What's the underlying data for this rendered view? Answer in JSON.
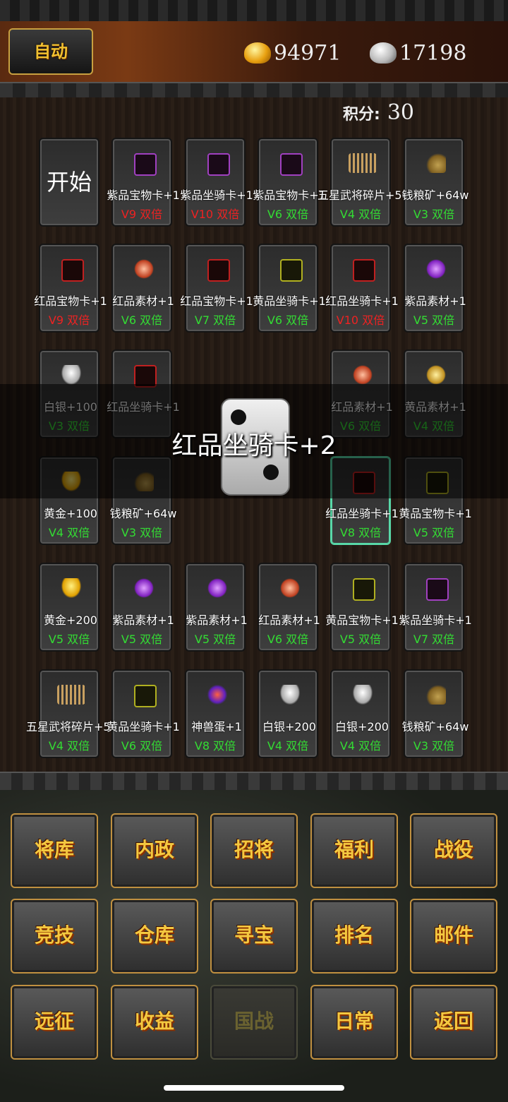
{
  "header": {
    "auto_label": "自动",
    "gold_value": "94971",
    "silver_value": "17198",
    "score_label": "积分:",
    "score_value": "30"
  },
  "board": {
    "start_label": "开始",
    "cells": [
      {
        "icon": "purple-card-icon",
        "name": "紫品宝物卡+1",
        "mult": "V9 双倍",
        "mult_color": "red"
      },
      {
        "icon": "purple-card-icon",
        "name": "紫品坐骑卡+1",
        "mult": "V10 双倍",
        "mult_color": "red"
      },
      {
        "icon": "purple-card-icon",
        "name": "紫品宝物卡+1",
        "mult": "V6 双倍",
        "mult_color": "green"
      },
      {
        "icon": "hero-shard-icon",
        "name": "五星武将碎片+50",
        "mult": "V4 双倍",
        "mult_color": "green"
      },
      {
        "icon": "ore-icon",
        "name": "钱粮矿+64w",
        "mult": "V3 双倍",
        "mult_color": "green"
      },
      {
        "icon": "red-card-icon",
        "name": "红品宝物卡+1",
        "mult": "V9 双倍",
        "mult_color": "red"
      },
      {
        "icon": "red-gem-icon",
        "name": "红品素材+1",
        "mult": "V6 双倍",
        "mult_color": "green"
      },
      {
        "icon": "red-card-icon",
        "name": "红品宝物卡+1",
        "mult": "V7 双倍",
        "mult_color": "green"
      },
      {
        "icon": "yellow-card-icon",
        "name": "黄品坐骑卡+1",
        "mult": "V6 双倍",
        "mult_color": "green"
      },
      {
        "icon": "red-card-icon",
        "name": "红品坐骑卡+1",
        "mult": "V10 双倍",
        "mult_color": "red"
      },
      {
        "icon": "purple-gem-icon",
        "name": "紫品素材+1",
        "mult": "V5 双倍",
        "mult_color": "green"
      },
      {
        "icon": "silver-icon",
        "name": "白银+100",
        "mult": "V3 双倍",
        "mult_color": "green"
      },
      {
        "icon": "red-card-icon",
        "name": "红品坐骑卡+1",
        "mult": "",
        "mult_color": "green"
      },
      {
        "icon": "red-gem-icon",
        "name": "红品素材+1",
        "mult": "V6 双倍",
        "mult_color": "green"
      },
      {
        "icon": "yellow-gem-icon",
        "name": "黄品素材+1",
        "mult": "V4 双倍",
        "mult_color": "green"
      },
      {
        "icon": "gold-icon",
        "name": "黄金+100",
        "mult": "V4 双倍",
        "mult_color": "green"
      },
      {
        "icon": "ore-icon",
        "name": "钱粮矿+64w",
        "mult": "V3 双倍",
        "mult_color": "green"
      },
      {
        "icon": "red-card-icon",
        "name": "红品坐骑卡+1",
        "mult": "V8 双倍",
        "mult_color": "green",
        "selected": true
      },
      {
        "icon": "yellow-card-icon",
        "name": "黄品宝物卡+1",
        "mult": "V5 双倍",
        "mult_color": "green"
      },
      {
        "icon": "gold-icon",
        "name": "黄金+200",
        "mult": "V5 双倍",
        "mult_color": "green"
      },
      {
        "icon": "purple-gem-icon",
        "name": "紫品素材+1",
        "mult": "V5 双倍",
        "mult_color": "green"
      },
      {
        "icon": "purple-gem-icon",
        "name": "紫品素材+1",
        "mult": "V5 双倍",
        "mult_color": "green"
      },
      {
        "icon": "red-gem-icon",
        "name": "红品素材+1",
        "mult": "V6 双倍",
        "mult_color": "green"
      },
      {
        "icon": "yellow-card-icon",
        "name": "黄品宝物卡+1",
        "mult": "V5 双倍",
        "mult_color": "green"
      },
      {
        "icon": "purple-card-icon",
        "name": "紫品坐骑卡+1",
        "mult": "V7 双倍",
        "mult_color": "green"
      },
      {
        "icon": "hero-shard-icon",
        "name": "五星武将碎片+50",
        "mult": "V4 双倍",
        "mult_color": "green"
      },
      {
        "icon": "yellow-card-icon",
        "name": "黄品坐骑卡+1",
        "mult": "V6 双倍",
        "mult_color": "green"
      },
      {
        "icon": "beast-egg-icon",
        "name": "神兽蛋+1",
        "mult": "V8 双倍",
        "mult_color": "green"
      },
      {
        "icon": "silver-icon",
        "name": "白银+200",
        "mult": "V4 双倍",
        "mult_color": "green"
      },
      {
        "icon": "silver-icon",
        "name": "白银+200",
        "mult": "V4 双倍",
        "mult_color": "green"
      },
      {
        "icon": "ore-icon",
        "name": "钱粮矿+64w",
        "mult": "V3 双倍",
        "mult_color": "green"
      }
    ]
  },
  "result": {
    "text": "红品坐骑卡+2",
    "dice_value": 2
  },
  "menu": {
    "buttons": [
      {
        "label": "将库",
        "enabled": true
      },
      {
        "label": "内政",
        "enabled": true
      },
      {
        "label": "招将",
        "enabled": true
      },
      {
        "label": "福利",
        "enabled": true
      },
      {
        "label": "战役",
        "enabled": true
      },
      {
        "label": "竞技",
        "enabled": true
      },
      {
        "label": "仓库",
        "enabled": true
      },
      {
        "label": "寻宝",
        "enabled": true
      },
      {
        "label": "排名",
        "enabled": true
      },
      {
        "label": "邮件",
        "enabled": true
      },
      {
        "label": "远征",
        "enabled": true
      },
      {
        "label": "收益",
        "enabled": true
      },
      {
        "label": "国战",
        "enabled": false
      },
      {
        "label": "日常",
        "enabled": true
      },
      {
        "label": "返回",
        "enabled": true
      }
    ]
  },
  "colors": {
    "green": "#33dd33",
    "red": "#ee2222",
    "menu_text": "#f4c840",
    "selected_border": "#58d8a8"
  }
}
